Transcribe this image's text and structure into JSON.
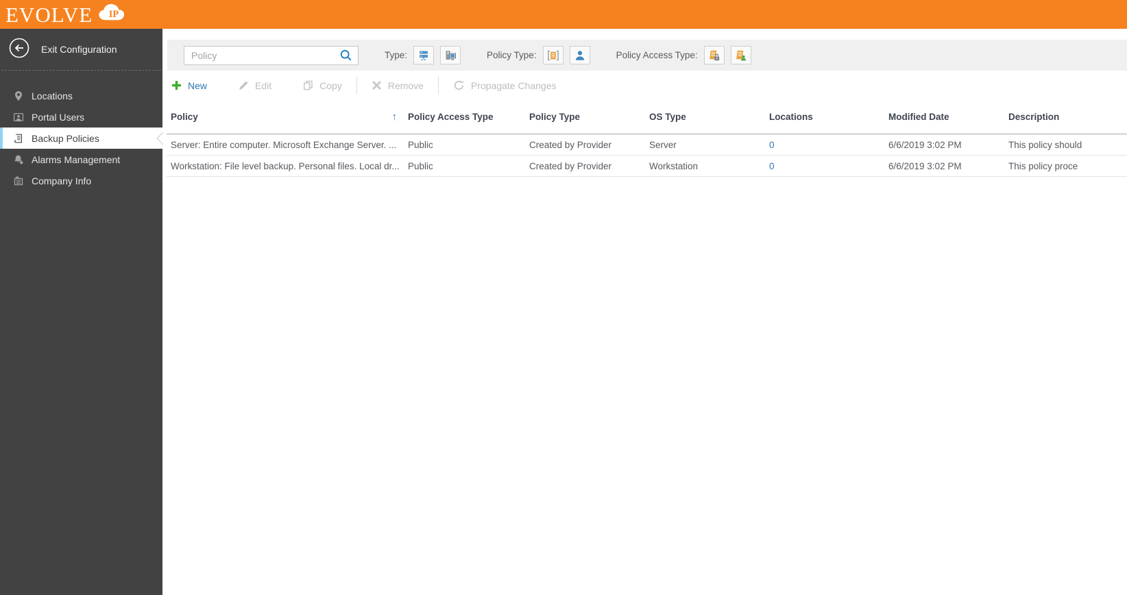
{
  "brand": {
    "logo_text": "EVOLVE",
    "logo_badge": "IP"
  },
  "sidebar": {
    "exit_label": "Exit Configuration",
    "items": [
      {
        "label": "Locations",
        "icon": "location-pin-icon",
        "selected": false
      },
      {
        "label": "Portal Users",
        "icon": "portal-users-icon",
        "selected": false
      },
      {
        "label": "Backup Policies",
        "icon": "backup-policies-icon",
        "selected": true
      },
      {
        "label": "Alarms Management",
        "icon": "alarms-icon",
        "selected": false
      },
      {
        "label": "Company Info",
        "icon": "company-info-icon",
        "selected": false
      }
    ]
  },
  "filters": {
    "search": {
      "placeholder": "Policy",
      "icon": "search-icon"
    },
    "groups": [
      {
        "label": "Type:",
        "icons": [
          "server-type-icon",
          "workstation-type-icon"
        ]
      },
      {
        "label": "Policy Type:",
        "icons": [
          "provider-policy-icon",
          "user-policy-icon"
        ]
      },
      {
        "label": "Policy Access Type:",
        "icons": [
          "private-access-icon",
          "public-access-icon"
        ]
      }
    ]
  },
  "toolbar": {
    "buttons": [
      {
        "label": "New",
        "icon": "plus-icon",
        "enabled": true
      },
      {
        "label": "Edit",
        "icon": "pencil-icon",
        "enabled": false
      },
      {
        "label": "Copy",
        "icon": "copy-icon",
        "enabled": false
      },
      {
        "label": "Remove",
        "icon": "x-icon",
        "enabled": false
      },
      {
        "label": "Propagate Changes",
        "icon": "refresh-icon",
        "enabled": false
      }
    ]
  },
  "table": {
    "columns": [
      "Policy",
      "Policy Access Type",
      "Policy Type",
      "OS Type",
      "Locations",
      "Modified Date",
      "Description"
    ],
    "sort": {
      "column": "Policy",
      "direction": "asc",
      "glyph": "↑"
    },
    "rows": [
      {
        "policy": "Server: Entire computer. Microsoft Exchange Server. ...",
        "policy_access_type": "Public",
        "policy_type": "Created by Provider",
        "os_type": "Server",
        "locations": "0",
        "modified_date": "6/6/2019 3:02 PM",
        "description": "This policy should"
      },
      {
        "policy": "Workstation: File level backup. Personal files. Local dr...",
        "policy_access_type": "Public",
        "policy_type": "Created by Provider",
        "os_type": "Workstation",
        "locations": "0",
        "modified_date": "6/6/2019 3:02 PM",
        "description": "This policy proce"
      }
    ]
  },
  "colors": {
    "brand_orange": "#F5821F",
    "accent_blue": "#2E76B5",
    "success_green": "#3DAE2B",
    "selected_accent": "#8ED4F2",
    "sidebar_bg": "#424242",
    "scroll_amber": "#E9A13B"
  }
}
